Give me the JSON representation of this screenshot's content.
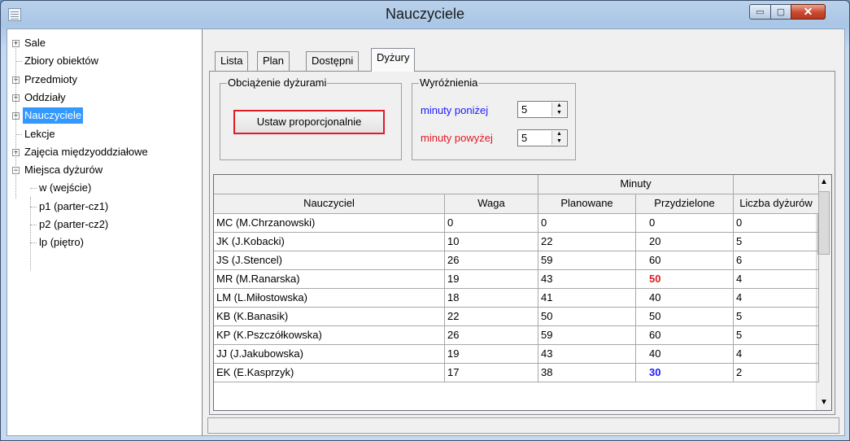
{
  "window": {
    "title": "Nauczyciele"
  },
  "title_buttons": {
    "minimize": "▭",
    "maximize": "▢",
    "close": "✕"
  },
  "tree": {
    "items": [
      {
        "label": "Sale",
        "expander": "+"
      },
      {
        "label": "Zbiory obiektów",
        "expander": ""
      },
      {
        "label": "Przedmioty",
        "expander": "+"
      },
      {
        "label": "Oddziały",
        "expander": "+"
      },
      {
        "label": "Nauczyciele",
        "expander": "+",
        "selected": true
      },
      {
        "label": "Lekcje",
        "expander": ""
      },
      {
        "label": "Zajęcia międzyoddziałowe",
        "expander": "+"
      },
      {
        "label": "Miejsca dyżurów",
        "expander": "−"
      },
      {
        "label": "w (wejście)",
        "expander": ""
      },
      {
        "label": "p1 (parter-cz1)",
        "expander": ""
      },
      {
        "label": "p2 (parter-cz2)",
        "expander": ""
      },
      {
        "label": "lp (piętro)",
        "expander": ""
      }
    ]
  },
  "tabs": [
    "Lista",
    "Plan",
    "Dostępni",
    "Dyżury"
  ],
  "active_tab": "Dyżury",
  "load_group": {
    "title": "Obciążenie dyżurami",
    "button": "Ustaw proporcjonalnie"
  },
  "highlight_group": {
    "title": "Wyróżnienia",
    "below_label": "minuty poniżej",
    "below_value": "5",
    "above_label": "minuty powyżej",
    "above_value": "5",
    "below_color": "#1a1aff",
    "above_color": "#e01b24"
  },
  "grid": {
    "group_header": "Minuty",
    "columns": [
      "Nauczyciel",
      "Waga",
      "Planowane",
      "Przydzielone",
      "Liczba dyżurów"
    ],
    "rows": [
      {
        "teacher": "MC (M.Chrzanowski)",
        "weight": "0",
        "planned": "0",
        "assigned": "0",
        "count": "0",
        "mark": ""
      },
      {
        "teacher": "JK (J.Kobacki)",
        "weight": "10",
        "planned": "22",
        "assigned": "20",
        "count": "5",
        "mark": ""
      },
      {
        "teacher": "JS (J.Stencel)",
        "weight": "26",
        "planned": "59",
        "assigned": "60",
        "count": "6",
        "mark": ""
      },
      {
        "teacher": "MR (M.Ranarska)",
        "weight": "19",
        "planned": "43",
        "assigned": "50",
        "count": "4",
        "mark": "above"
      },
      {
        "teacher": "LM (L.Miłostowska)",
        "weight": "18",
        "planned": "41",
        "assigned": "40",
        "count": "4",
        "mark": ""
      },
      {
        "teacher": "KB (K.Banasik)",
        "weight": "22",
        "planned": "50",
        "assigned": "50",
        "count": "5",
        "mark": ""
      },
      {
        "teacher": "KP (K.Pszczółkowska)",
        "weight": "26",
        "planned": "59",
        "assigned": "60",
        "count": "5",
        "mark": ""
      },
      {
        "teacher": "JJ (J.Jakubowska)",
        "weight": "19",
        "planned": "43",
        "assigned": "40",
        "count": "4",
        "mark": ""
      },
      {
        "teacher": "EK (E.Kasprzyk)",
        "weight": "17",
        "planned": "38",
        "assigned": "30",
        "count": "2",
        "mark": "below"
      }
    ]
  },
  "statusbar": {
    "text": ""
  }
}
